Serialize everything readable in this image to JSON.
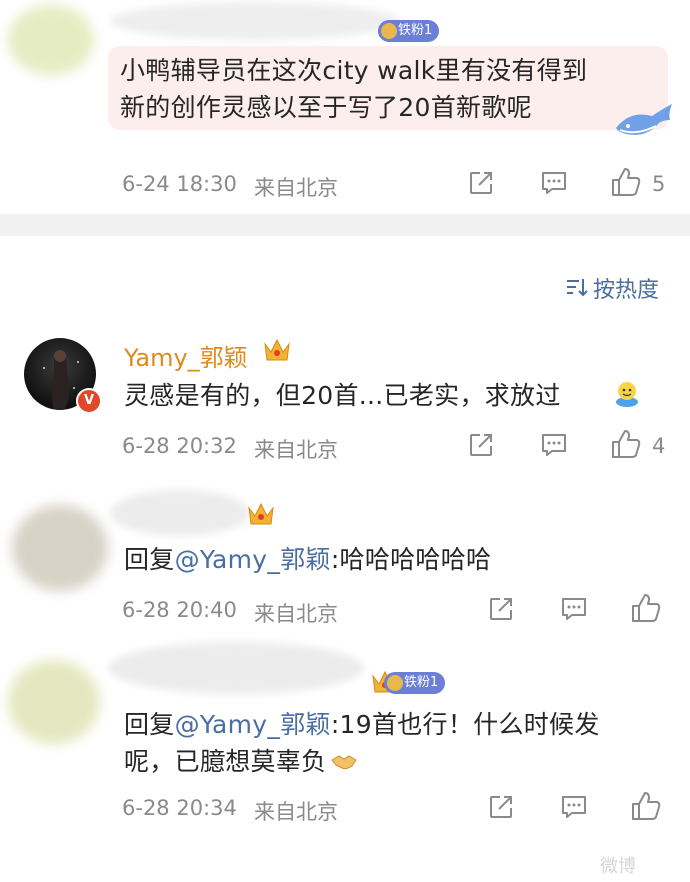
{
  "top_comment": {
    "fan_badge": "铁粉1",
    "text_line1": "小鸭辅导员在这次city walk里有没有得到",
    "text_line2": "新的创作灵感以至于写了20首新歌呢",
    "time": "6-24 18:30",
    "location": "来自北京",
    "like_count": "5"
  },
  "sort": {
    "label": "按热度"
  },
  "comments": [
    {
      "username": "Yamy_郭颖",
      "text": "灵感是有的，但20首...已老实，求放过",
      "time": "6-28 20:32",
      "location": "来自北京",
      "like_count": "4"
    },
    {
      "reply_prefix": "回复",
      "mention": "@Yamy_郭颖",
      "text": ":哈哈哈哈哈哈",
      "time": "6-28 20:40",
      "location": "来自北京"
    },
    {
      "fan_badge": "铁粉1",
      "reply_prefix": "回复",
      "mention": "@Yamy_郭颖",
      "text_line1": ":19首也行！什么时候发",
      "text_line2": "呢，已臆想莫辜负",
      "time": "6-28 20:34",
      "location": "来自北京"
    }
  ],
  "watermark": "微博"
}
